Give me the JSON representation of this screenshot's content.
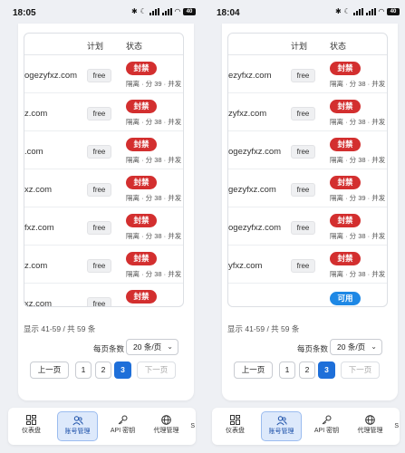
{
  "screens": [
    {
      "status": {
        "time": "18:05",
        "battery": "40"
      },
      "table": {
        "col_plan": "计划",
        "col_status": "状态",
        "rows": [
          {
            "domain": "ogezyfxz.com",
            "plan": "free",
            "status": "封禁",
            "meta": "隔离 · 分 39 · 并发 0"
          },
          {
            "domain": "z.com",
            "plan": "free",
            "status": "封禁",
            "meta": "隔离 · 分 38 · 并发 0"
          },
          {
            "domain": ".com",
            "plan": "free",
            "status": "封禁",
            "meta": "隔离 · 分 38 · 并发 0"
          },
          {
            "domain": "xz.com",
            "plan": "free",
            "status": "封禁",
            "meta": "隔离 · 分 38 · 并发 0"
          },
          {
            "domain": "fxz.com",
            "plan": "free",
            "status": "封禁",
            "meta": "隔离 · 分 38 · 并发 0"
          },
          {
            "domain": "z.com",
            "plan": "free",
            "status": "封禁",
            "meta": "隔离 · 分 38 · 并发 0"
          },
          {
            "domain": "xz.com",
            "plan": "free",
            "status": "封禁",
            "meta": ""
          }
        ]
      }
    },
    {
      "status": {
        "time": "18:04",
        "battery": "40"
      },
      "table": {
        "col_plan": "计划",
        "col_status": "状态",
        "rows": [
          {
            "domain": "ezyfxz.com",
            "plan": "free",
            "status": "封禁",
            "meta": "隔离 · 分 38 · 并发 0"
          },
          {
            "domain": "zyfxz.com",
            "plan": "free",
            "status": "封禁",
            "meta": "隔离 · 分 38 · 并发 0"
          },
          {
            "domain": "ogezyfxz.com",
            "plan": "free",
            "status": "封禁",
            "meta": "隔离 · 分 38 · 并发 0"
          },
          {
            "domain": "gezyfxz.com",
            "plan": "free",
            "status": "封禁",
            "meta": "隔离 · 分 39 · 并发 0"
          },
          {
            "domain": "ogezyfxz.com",
            "plan": "free",
            "status": "封禁",
            "meta": "隔离 · 分 38 · 并发 0"
          },
          {
            "domain": "yfxz.com",
            "plan": "free",
            "status": "封禁",
            "meta": "隔离 · 分 38 · 并发 0"
          },
          {
            "domain": "",
            "plan": "",
            "status": "可用",
            "meta": ""
          }
        ]
      }
    }
  ],
  "pagination": {
    "showing": "显示 41-59 / 共 59 条",
    "per_page_label": "每页条数",
    "per_page_value": "20 条/页",
    "prev": "上一页",
    "next": "下一页",
    "pages": [
      "1",
      "2",
      "3"
    ]
  },
  "nav": {
    "items": [
      {
        "label": "仪表盘",
        "icon": "dashboard-icon"
      },
      {
        "label": "账号管理",
        "icon": "users-icon"
      },
      {
        "label": "API 密钥",
        "icon": "key-icon"
      },
      {
        "label": "代理管理",
        "icon": "globe-icon"
      }
    ],
    "edge": "S"
  },
  "colors": {
    "banned": "#d32f2f",
    "available": "#1e88e5",
    "active_page": "#1e6fd9"
  }
}
